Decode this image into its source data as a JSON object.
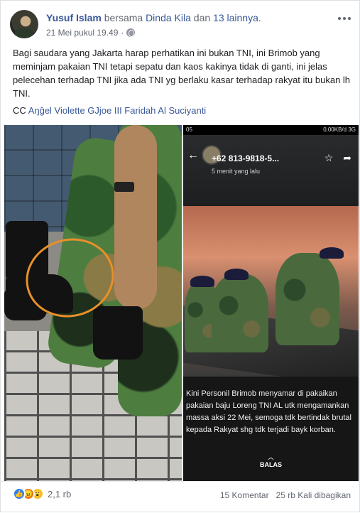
{
  "post": {
    "author": "Yusuf Islam",
    "with_word": "bersama",
    "tagged_person": "Dinda Kila",
    "and_word": "dan",
    "others": "13 lainnya.",
    "timestamp": "21 Mei pukul 19.49",
    "dot": "·",
    "text": "Bagi saudara yang Jakarta harap perhatikan ini bukan TNI, ini Brimob yang meminjam pakaian TNI tetapi sepatu dan kaos kakinya tidak di ganti, ini jelas pelecehan terhadap TNI jika ada TNI yg berlaku kasar terhadap rakyat itu bukan lh TNI.",
    "cc_label": "CC",
    "cc_mentions": "Aŋĝel Violette GJjoe III Faridah Al Suciyanti"
  },
  "screenshot": {
    "status_left": "05",
    "status_right": "0,00KB/d 3G",
    "number": "+62 813-9818-5...",
    "time_ago": "5 menit yang lalu",
    "caption": "Kini Personil Brimob menyamar di pakaikan pakaian baju Loreng TNI AL utk mengamankan massa aksi 22 Mei, semoga tdk bertindak brutal kepada Rakyat shg tdk terjadi bayk korban.",
    "reply_label": "BALAS",
    "back_icon": "←",
    "star_icon": "☆",
    "share_icon": "➦",
    "chevron_icon": "︿"
  },
  "footer": {
    "reaction_count": "2,1 rb",
    "comments": "15 Komentar",
    "shares": "25 rb Kali dibagikan"
  },
  "colors": {
    "link": "#385898",
    "like": "#2d7ff9",
    "angry": "#e9710f",
    "wow": "#f7c22e",
    "highlight_circle": "#e8902a"
  },
  "icons": [
    "more-options-icon",
    "globe-icon",
    "like-reaction-icon",
    "angry-reaction-icon",
    "wow-reaction-icon"
  ]
}
